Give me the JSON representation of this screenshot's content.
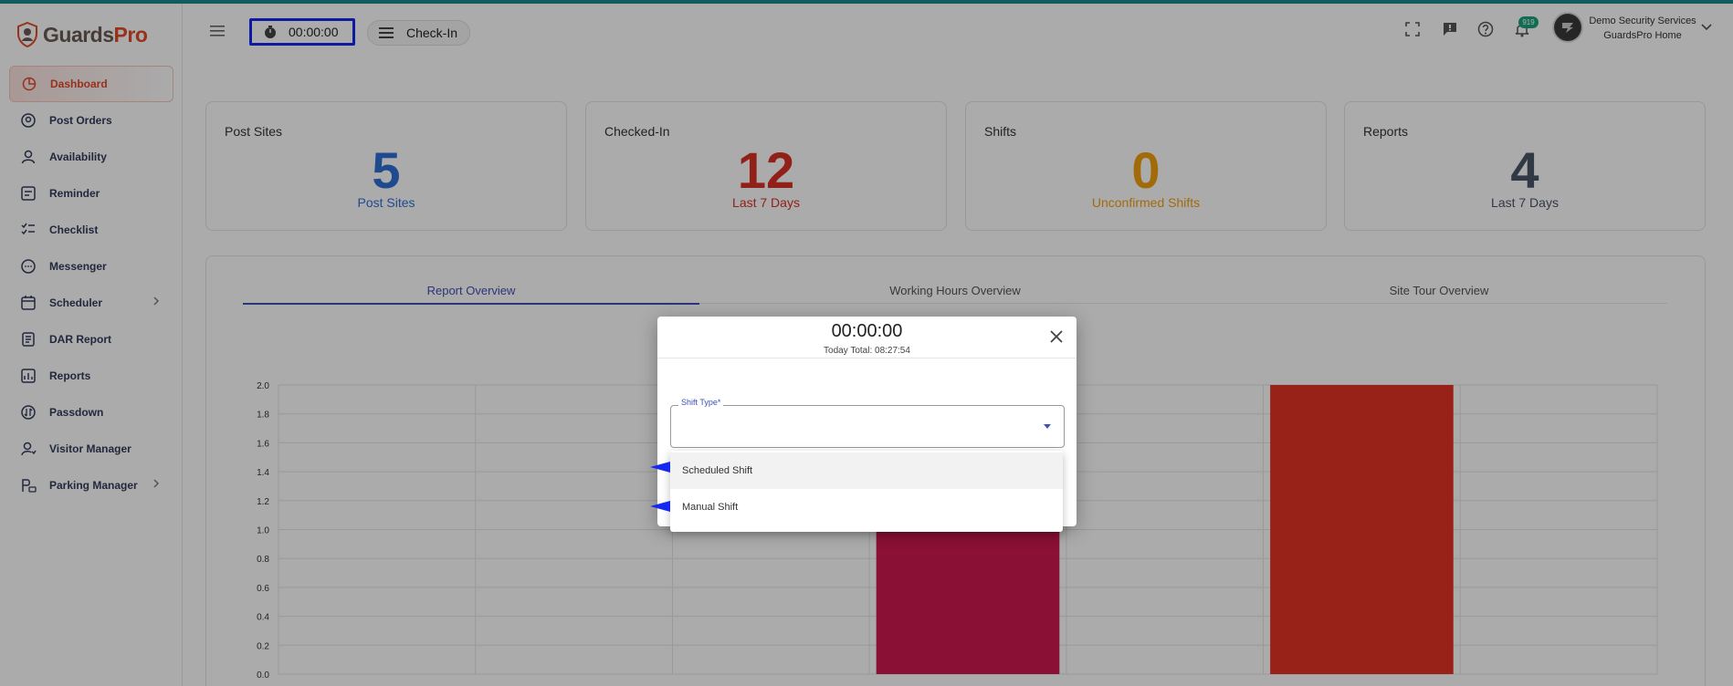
{
  "brand": {
    "name_part1": "Guards",
    "name_part2": "Pro"
  },
  "sidebar": {
    "items": [
      {
        "label": "Dashboard",
        "icon": "dashboard-icon",
        "active": true
      },
      {
        "label": "Post Orders",
        "icon": "post-orders-icon"
      },
      {
        "label": "Availability",
        "icon": "person-icon"
      },
      {
        "label": "Reminder",
        "icon": "reminder-icon"
      },
      {
        "label": "Checklist",
        "icon": "checklist-icon"
      },
      {
        "label": "Messenger",
        "icon": "chat-icon"
      },
      {
        "label": "Scheduler",
        "icon": "calendar-icon",
        "has_children": true
      },
      {
        "label": "DAR Report",
        "icon": "dar-report-icon"
      },
      {
        "label": "Reports",
        "icon": "reports-icon"
      },
      {
        "label": "Passdown",
        "icon": "passdown-icon"
      },
      {
        "label": "Visitor Manager",
        "icon": "visitor-icon"
      },
      {
        "label": "Parking Manager",
        "icon": "parking-icon",
        "has_children": true
      }
    ]
  },
  "header": {
    "timer": "00:00:00",
    "checkin_label": "Check-In",
    "notification_count": "919",
    "user_company": "Demo Security Services",
    "user_location": "GuardsPro Home"
  },
  "cards": [
    {
      "title": "Post Sites",
      "value": "5",
      "subtitle": "Post Sites",
      "color": "#2f6fd6"
    },
    {
      "title": "Checked-In",
      "value": "12",
      "subtitle": "Last 7 Days",
      "color": "#d93025"
    },
    {
      "title": "Shifts",
      "value": "0",
      "subtitle": "Unconfirmed Shifts",
      "color": "#f0a010"
    },
    {
      "title": "Reports",
      "value": "4",
      "subtitle": "Last 7 Days",
      "color": "#4a5568"
    }
  ],
  "tabs": [
    "Report Overview",
    "Working Hours Overview",
    "Site Tour Overview"
  ],
  "chart_data": {
    "type": "bar",
    "y_ticks": [
      "0.0",
      "0.2",
      "0.4",
      "0.6",
      "0.8",
      "1.0",
      "1.2",
      "1.4",
      "1.6",
      "1.8",
      "2.0"
    ],
    "ylim": [
      0,
      2.0
    ],
    "values": [
      0,
      0,
      0,
      1,
      0,
      2,
      0
    ],
    "colors": [
      "#d0184f",
      "#d0184f",
      "#d0184f",
      "#d0184f",
      "#d0184f",
      "#e33324",
      "#e33324"
    ],
    "grid": true
  },
  "modal": {
    "time": "00:00:00",
    "today_total": "Today Total: 08:27:54",
    "field_label": "Shift Type*",
    "options": [
      "Scheduled Shift",
      "Manual Shift"
    ]
  }
}
